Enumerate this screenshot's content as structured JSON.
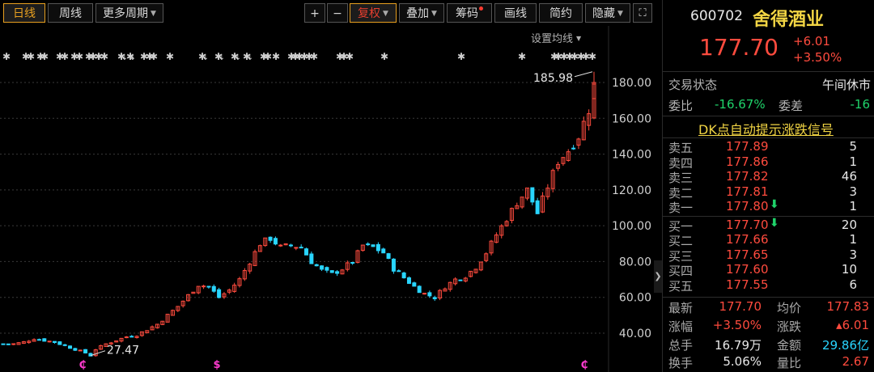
{
  "toolbar": {
    "period_day": "日线",
    "period_week": "周线",
    "period_more": "更多周期",
    "zoom_in": "+",
    "zoom_out": "−",
    "adjust": "复权",
    "overlay": "叠加",
    "chips": "筹码",
    "draw": "画线",
    "brief": "简约",
    "hide": "隐藏",
    "fullscreen_icon": "expand-icon"
  },
  "ma_setting_label": "设置均线",
  "colors": {
    "up": "#ff4b3e",
    "down": "#29d5ff",
    "accent": "#e8a020",
    "background": "#000000"
  },
  "chart_data": {
    "type": "candlestick",
    "yticks": [
      40.0,
      60.0,
      80.0,
      100.0,
      120.0,
      140.0,
      160.0,
      180.0
    ],
    "ylim": [
      27,
      190
    ],
    "annotations": {
      "high_label": "185.98",
      "low_label": "27.47"
    },
    "event_marks": [
      "₵",
      "$",
      "₵"
    ],
    "approx_close_path": [
      [
        0,
        34
      ],
      [
        2,
        34
      ],
      [
        4,
        35
      ],
      [
        6,
        37
      ],
      [
        8,
        36
      ],
      [
        10,
        35
      ],
      [
        12,
        33
      ],
      [
        14,
        31
      ],
      [
        16,
        29
      ],
      [
        17,
        27.5
      ],
      [
        18,
        31
      ],
      [
        20,
        34
      ],
      [
        22,
        36
      ],
      [
        24,
        38
      ],
      [
        26,
        39
      ],
      [
        28,
        42
      ],
      [
        30,
        45
      ],
      [
        32,
        50
      ],
      [
        34,
        55
      ],
      [
        36,
        61
      ],
      [
        38,
        67
      ],
      [
        40,
        66
      ],
      [
        42,
        60
      ],
      [
        44,
        64
      ],
      [
        46,
        70
      ],
      [
        48,
        80
      ],
      [
        50,
        90
      ],
      [
        52,
        93
      ],
      [
        54,
        88
      ],
      [
        56,
        89
      ],
      [
        58,
        88
      ],
      [
        60,
        80
      ],
      [
        62,
        75
      ],
      [
        64,
        73
      ],
      [
        66,
        76
      ],
      [
        68,
        80
      ],
      [
        70,
        89
      ],
      [
        72,
        88
      ],
      [
        74,
        85
      ],
      [
        76,
        76
      ],
      [
        78,
        71
      ],
      [
        80,
        66
      ],
      [
        82,
        62
      ],
      [
        84,
        60
      ],
      [
        86,
        66
      ],
      [
        88,
        70
      ],
      [
        90,
        72
      ],
      [
        92,
        77
      ],
      [
        94,
        85
      ],
      [
        96,
        95
      ],
      [
        98,
        104
      ],
      [
        100,
        113
      ],
      [
        102,
        120
      ],
      [
        104,
        107
      ],
      [
        106,
        122
      ],
      [
        108,
        136
      ],
      [
        110,
        142
      ],
      [
        112,
        150
      ],
      [
        114,
        165
      ],
      [
        115,
        178
      ]
    ]
  },
  "quote": {
    "code": "600702",
    "name": "舍得酒业",
    "price": "177.70",
    "change": "+6.01",
    "change_pct": "+3.50%",
    "status_label": "交易状态",
    "status_value": "午间休市",
    "wei_bi_label": "委比",
    "wei_bi_value": "-16.67%",
    "wei_cha_label": "委差",
    "wei_cha_value": "-16",
    "dk_signal": "DK点自动提示涨跌信号",
    "asks": [
      {
        "label": "卖五",
        "price": "177.89",
        "vol": "5"
      },
      {
        "label": "卖四",
        "price": "177.86",
        "vol": "1"
      },
      {
        "label": "卖三",
        "price": "177.82",
        "vol": "46"
      },
      {
        "label": "卖二",
        "price": "177.81",
        "vol": "3"
      },
      {
        "label": "卖一",
        "price": "177.80",
        "vol": "1"
      }
    ],
    "bids": [
      {
        "label": "买一",
        "price": "177.70",
        "vol": "20"
      },
      {
        "label": "买二",
        "price": "177.66",
        "vol": "1"
      },
      {
        "label": "买三",
        "price": "177.65",
        "vol": "3"
      },
      {
        "label": "买四",
        "price": "177.60",
        "vol": "10"
      },
      {
        "label": "买五",
        "price": "177.55",
        "vol": "6"
      }
    ],
    "stats": {
      "latest_label": "最新",
      "latest_value": "177.70",
      "avg_label": "均价",
      "avg_value": "177.83",
      "chg_pct_label": "涨幅",
      "chg_pct_value": "+3.50%",
      "chg_label": "涨跌",
      "chg_value": "▴6.01",
      "volume_label": "总手",
      "volume_value": "16.79万",
      "amount_label": "金额",
      "amount_value": "29.86亿",
      "turnover_label": "换手",
      "turnover_value": "5.06%",
      "ratio_label": "量比",
      "ratio_value": "2.67"
    }
  }
}
